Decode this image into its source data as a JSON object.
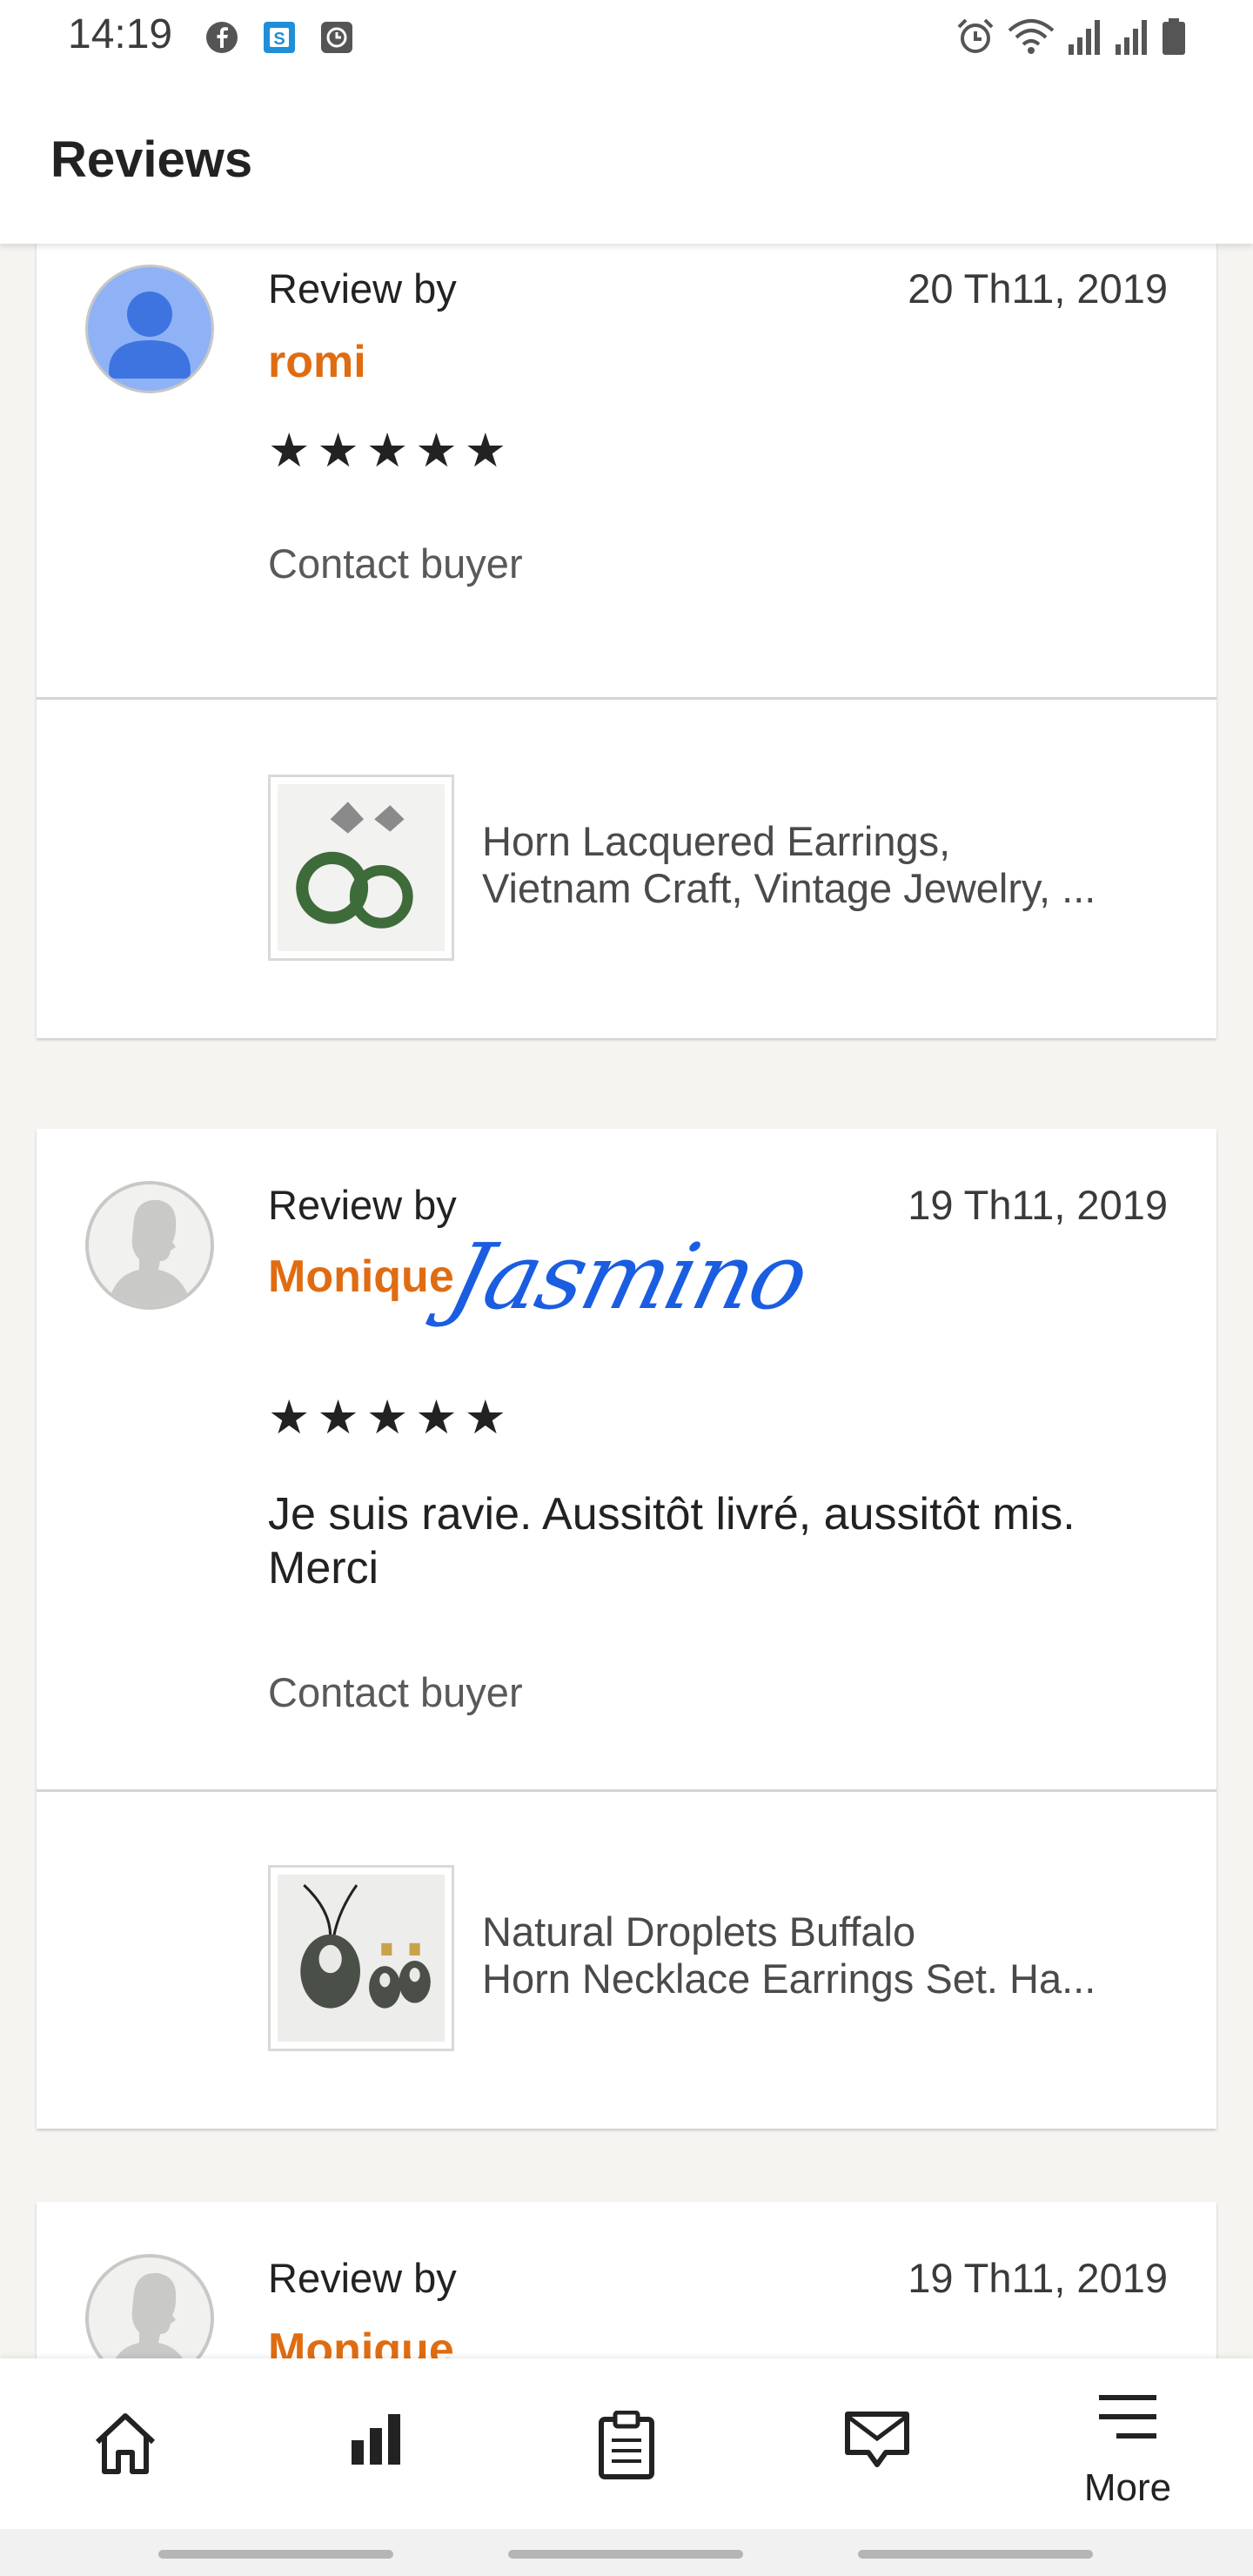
{
  "status_bar": {
    "time": "14:19"
  },
  "header": {
    "title": "Reviews"
  },
  "reviews": [
    {
      "label": "Review by",
      "reviewer": "romi",
      "date": "20 Th11, 2019",
      "rating": 5,
      "stars": "★★★★★",
      "text": "",
      "contact_label": "Contact buyer",
      "product": {
        "title_line1": "Horn Lacquered Earrings,",
        "title_line2": "Vietnam Craft, Vintage Jewelry, ..."
      }
    },
    {
      "label": "Review by",
      "reviewer": "Monique",
      "signature": "Jasmino",
      "date": "19 Th11, 2019",
      "rating": 5,
      "stars": "★★★★★",
      "text": "Je suis ravie. Aussitôt livré, aussitôt mis. Merci",
      "contact_label": "Contact buyer",
      "product": {
        "title_line1": "Natural Droplets Buffalo",
        "title_line2": "Horn Necklace Earrings Set. Ha..."
      }
    },
    {
      "label": "Review by",
      "reviewer": "Monique",
      "date": "19 Th11, 2019"
    }
  ],
  "bottom_nav": {
    "items": [
      {
        "icon": "home-icon"
      },
      {
        "icon": "stats-icon"
      },
      {
        "icon": "orders-icon"
      },
      {
        "icon": "messages-icon"
      },
      {
        "icon": "menu-icon",
        "label": "More"
      }
    ]
  },
  "colors": {
    "reviewer_name": "#e06c12",
    "signature": "#1a5de0",
    "avatar_default_bg": "#8fb2f7",
    "avatar_default_fg": "#3d74e0"
  }
}
